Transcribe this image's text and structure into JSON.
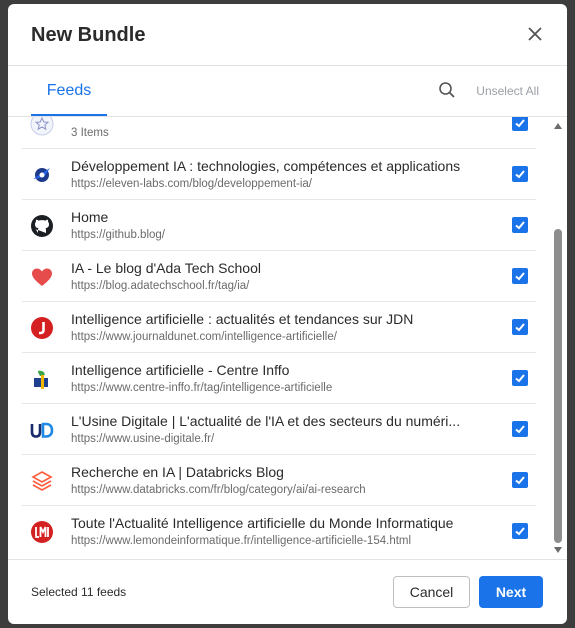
{
  "dialog": {
    "title": "New Bundle"
  },
  "tabs": [
    {
      "label": "Feeds",
      "active": true
    }
  ],
  "toolbar": {
    "unselect_all_label": "Unselect All",
    "search_icon": "search-icon"
  },
  "feeds": [
    {
      "title": "",
      "subtitle": "3 Items",
      "icon": "star-icon",
      "checked": true
    },
    {
      "title": "Développement IA : technologies, compétences et applications",
      "subtitle": "https://eleven-labs.com/blog/developpement-ia/",
      "icon": "eleven-labs-rocket-icon",
      "checked": true
    },
    {
      "title": "Home",
      "subtitle": "https://github.blog/",
      "icon": "github-icon",
      "checked": true
    },
    {
      "title": "IA - Le blog d'Ada Tech School",
      "subtitle": "https://blog.adatechschool.fr/tag/ia/",
      "icon": "heart-icon",
      "checked": true
    },
    {
      "title": "Intelligence artificielle : actualités et tendances sur JDN",
      "subtitle": "https://www.journaldunet.com/intelligence-artificielle/",
      "icon": "jdn-logo-icon",
      "checked": true
    },
    {
      "title": "Intelligence artificielle - Centre Inffo",
      "subtitle": "https://www.centre-inffo.fr/tag/intelligence-artificielle",
      "icon": "centre-inffo-logo-icon",
      "checked": true
    },
    {
      "title": "L'Usine Digitale | L'actualité de l'IA et des secteurs du numéri...",
      "subtitle": "https://www.usine-digitale.fr/",
      "icon": "usine-digitale-logo-icon",
      "checked": true
    },
    {
      "title": "Recherche en IA | Databricks Blog",
      "subtitle": "https://www.databricks.com/fr/blog/category/ai/ai-research",
      "icon": "databricks-logo-icon",
      "checked": true
    },
    {
      "title": "Toute l'Actualité Intelligence artificielle du Monde Informatique",
      "subtitle": "https://www.lemondeinformatique.fr/intelligence-artificielle-154.html",
      "icon": "lmi-logo-icon",
      "checked": true
    }
  ],
  "footer": {
    "selected_text": "Selected 11 feeds",
    "cancel_label": "Cancel",
    "next_label": "Next"
  },
  "colors": {
    "accent": "#1a73e8",
    "overlay": "#3d3d3d"
  }
}
